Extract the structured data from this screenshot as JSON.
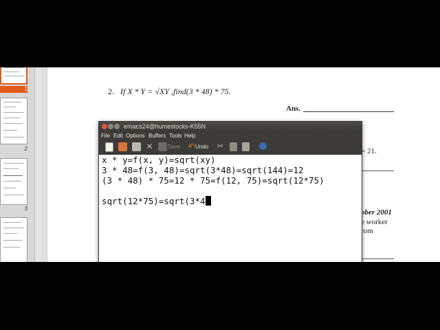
{
  "thumbnails": {
    "labels": [
      "1",
      "2",
      "3"
    ]
  },
  "document": {
    "question_number": "2.",
    "question_text": "If X * Y = √XY ,find(3 * 48) * 75.",
    "answer_label": "Ans.",
    "right_edge_text": {
      "eq": "= 21.",
      "date": "ober 2001",
      "worker": "e worker",
      "from": "rom"
    }
  },
  "emacs": {
    "title": "emacs24@humestocks-K55N",
    "menu": [
      "File",
      "Edit",
      "Options",
      "Buffers",
      "Tools",
      "Help"
    ],
    "toolbar": {
      "save_label": "Save",
      "undo_label": "Undo",
      "icons": [
        "new-file-icon",
        "open-folder-icon",
        "open-dired-icon",
        "close-icon",
        "save-icon",
        "undo-icon",
        "cut-icon",
        "copy-icon",
        "paste-icon",
        "search-icon"
      ]
    },
    "buffer_lines": [
      "x * y=f(x, y)=sqrt(xy)",
      "3 * 48=f(3, 48)=sqrt(3*48)=sqrt(144)=12",
      "(3 * 48) * 75=12 * 75=f(12, 75)=sqrt(12*75)",
      "",
      "sqrt(12*75)=sqrt(3*4"
    ]
  },
  "colors": {
    "accent": "#e05a1a",
    "titlebar": "#3c3b37",
    "close_button": "#e2543b"
  }
}
